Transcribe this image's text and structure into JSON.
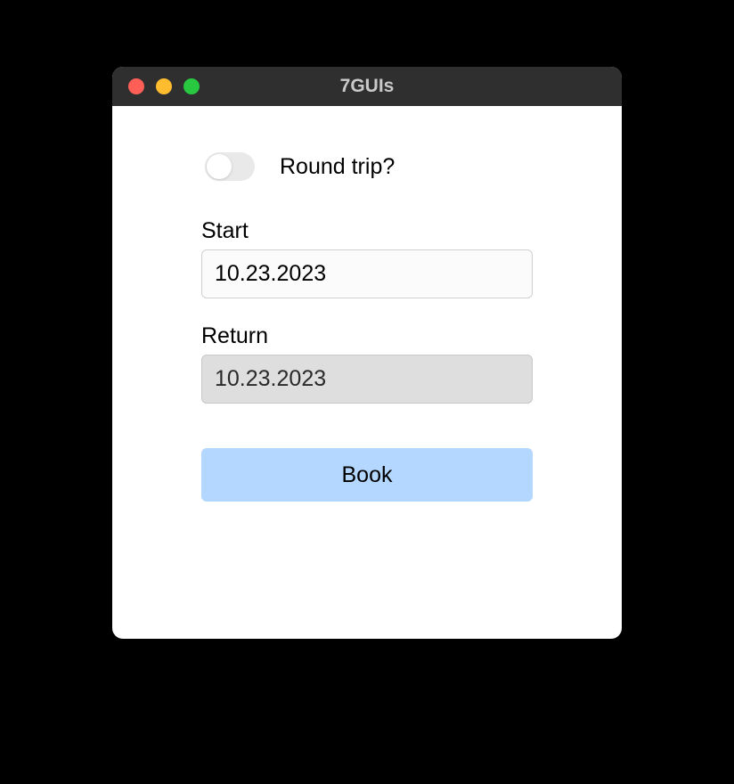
{
  "window": {
    "title": "7GUIs"
  },
  "form": {
    "toggle": {
      "label": "Round trip?",
      "checked": false
    },
    "start": {
      "label": "Start",
      "value": "10.23.2023"
    },
    "return": {
      "label": "Return",
      "value": "10.23.2023",
      "disabled": true
    },
    "book": {
      "label": "Book"
    }
  },
  "colors": {
    "book_button_bg": "#b3d7ff",
    "titlebar_bg": "#2f2f2f",
    "disabled_input_bg": "#dedede"
  }
}
